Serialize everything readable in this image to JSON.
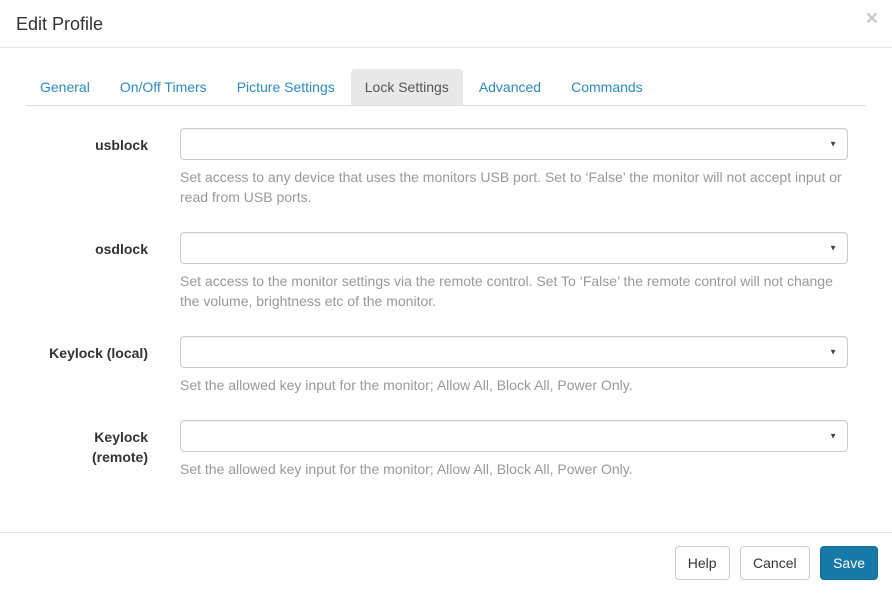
{
  "modal": {
    "title": "Edit Profile"
  },
  "icons": {
    "close": "×",
    "caret": "▼"
  },
  "tabs": [
    {
      "label": "General",
      "active": false
    },
    {
      "label": "On/Off Timers",
      "active": false
    },
    {
      "label": "Picture Settings",
      "active": false
    },
    {
      "label": "Lock Settings",
      "active": true
    },
    {
      "label": "Advanced",
      "active": false
    },
    {
      "label": "Commands",
      "active": false
    }
  ],
  "form": {
    "fields": [
      {
        "label": "usblock",
        "value": "",
        "help": "Set access to any device that uses the monitors USB port. Set to ‘False’ the monitor will not accept input or read from USB ports."
      },
      {
        "label": "osdlock",
        "value": "",
        "help": "Set access to the monitor settings via the remote control. Set To ‘False’ the remote control will not change the volume, brightness etc of the monitor."
      },
      {
        "label": "Keylock (local)",
        "value": "",
        "help": "Set the allowed key input for the monitor; Allow All, Block All, Power Only."
      },
      {
        "label": "Keylock (remote)",
        "value": "",
        "help": "Set the allowed key input for the monitor; Allow All, Block All, Power Only."
      }
    ]
  },
  "footer": {
    "help_label": "Help",
    "cancel_label": "Cancel",
    "save_label": "Save"
  },
  "colors": {
    "accent": "#1779a8",
    "tab_link": "#2b8cc2",
    "active_tab_bg": "#e8e8e8",
    "help_text": "#999999",
    "border": "#cccccc"
  }
}
